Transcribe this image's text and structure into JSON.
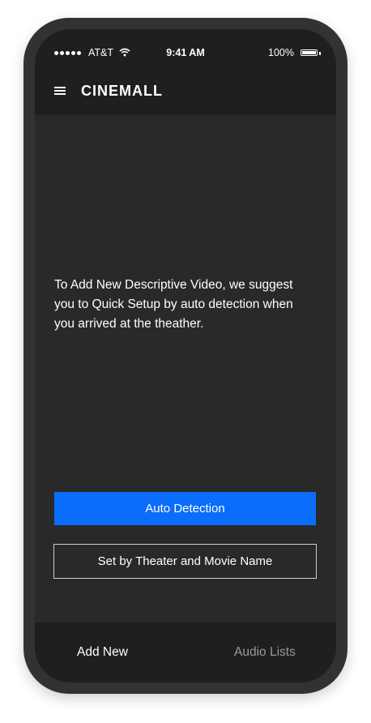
{
  "status_bar": {
    "carrier": "AT&T",
    "time": "9:41 AM",
    "battery": "100%",
    "icons": [
      "signal-icon",
      "wifi-icon",
      "battery-icon"
    ]
  },
  "nav": {
    "menu_icon": "hamburger-icon",
    "logo": "CINEMALL"
  },
  "main": {
    "message": "To Add New Descriptive Video,  we suggest you to Quick Setup by auto detection when you arrived at the theather.",
    "primary_button": "Auto Detection",
    "secondary_button": "Set by Theater and Movie Name"
  },
  "tabs": [
    {
      "label": "Add New",
      "active": true
    },
    {
      "label": "Audio Lists",
      "active": false
    }
  ],
  "colors": {
    "accent": "#0a6dfc",
    "background": "#292929",
    "bars": "#1f1f1f",
    "inactive_tab": "#9a9a9a"
  }
}
